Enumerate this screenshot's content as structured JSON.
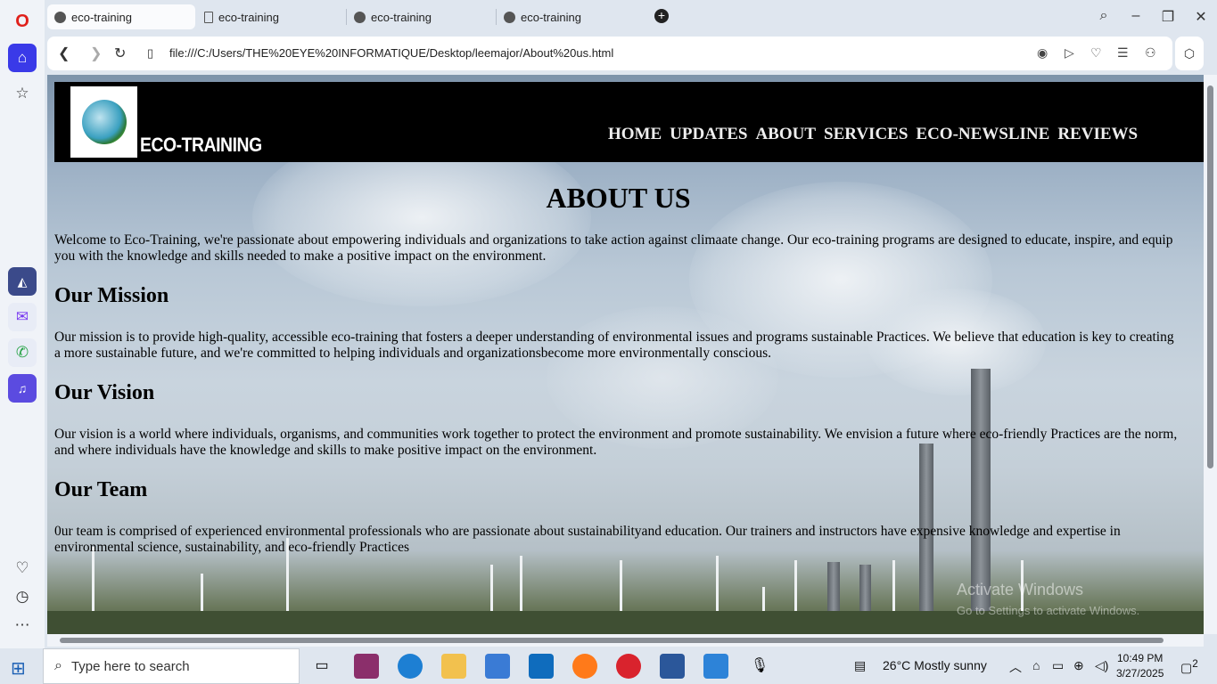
{
  "browser": {
    "tabs": [
      {
        "title": "eco-training",
        "active": true
      },
      {
        "title": "eco-training",
        "active": false
      },
      {
        "title": "eco-training",
        "active": false
      },
      {
        "title": "eco-training",
        "active": false
      }
    ],
    "url": "file:///C:/Users/THE%20EYE%20INFORMATIQUE/Desktop/leemajor/About%20us.html"
  },
  "site": {
    "brand": "ECO-TRAINING",
    "nav": [
      "HOME",
      "UPDATES",
      "ABOUT",
      "SERVICES",
      "ECO-NEWSLINE",
      "REVIEWS"
    ],
    "title": "ABOUT US",
    "intro": "Welcome to Eco-Training, we're passionate about empowering individuals and organizations to take action against climaate change. Our eco-training programs are designed to educate, inspire, and equip you with the knowledge and skills needed to make a positive impact on the environment.",
    "sections": [
      {
        "heading": "Our Mission",
        "text": "Our mission is to provide high-quality, accessible eco-training that fosters a deeper understanding of environmental issues and programs sustainable Practices. We believe that education is key to creating a more sustainable future, and we're committed to helping individuals and organizationsbecome more environmentally conscious."
      },
      {
        "heading": "Our Vision",
        "text": "Our vision is a world where individuals, organisms, and communities work together to protect the environment and promote sustainability. We envision a future where eco-friendly Practices are the norm, and where individuals have the knowledge and skills to make positive impact on the environment."
      },
      {
        "heading": "Our Team",
        "text": "0ur team is comprised of experienced environmental professionals who are passionate about sustainabilityand education. Our trainers and instructors have expensive knowledge and expertise in environmental science, sustainability, and eco-friendly Practices"
      }
    ]
  },
  "watermark": {
    "line1": "Activate Windows",
    "line2": "Go to Settings to activate Windows."
  },
  "taskbar": {
    "search_placeholder": "Type here to search",
    "weather": "26°C  Mostly sunny",
    "time": "10:49 PM",
    "date": "3/27/2025",
    "notifications": "2"
  }
}
